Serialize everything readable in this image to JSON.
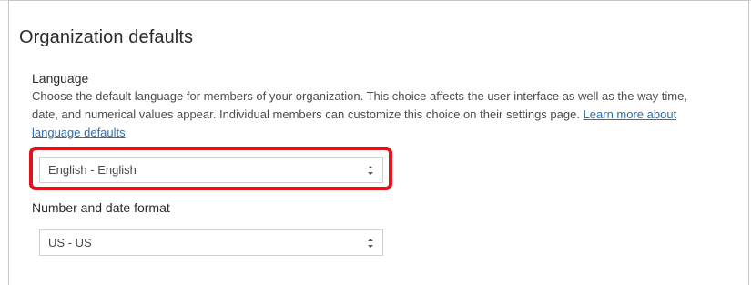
{
  "section": {
    "title": "Organization defaults"
  },
  "language": {
    "label": "Language",
    "description": "Choose the default language for members of your organization. This choice affects the user interface as well as the way time, date, and numerical values appear. Individual members can customize this choice on their settings page. ",
    "link_text": "Learn more about language defaults",
    "selected_value": "English - English"
  },
  "number_date_format": {
    "label": "Number and date format",
    "selected_value": "US - US"
  },
  "colors": {
    "highlight": "#e0141b",
    "link": "#2b6fb0"
  },
  "icons": {
    "select_arrows": "chevron-up-down-icon"
  }
}
